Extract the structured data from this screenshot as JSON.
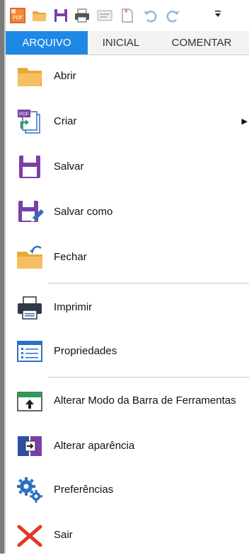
{
  "toolbar": {
    "buttons": [
      {
        "icon": "app-logo-icon"
      },
      {
        "icon": "open-folder-icon"
      },
      {
        "icon": "save-icon"
      },
      {
        "icon": "print-icon"
      },
      {
        "icon": "form-icon"
      },
      {
        "icon": "new-document-icon"
      },
      {
        "icon": "undo-icon"
      },
      {
        "icon": "redo-icon"
      },
      {
        "icon": "customize-dropdown-icon"
      }
    ]
  },
  "tabs": [
    {
      "label": "ARQUIVO",
      "active": true
    },
    {
      "label": "INICIAL",
      "active": false
    },
    {
      "label": "COMENTAR",
      "active": false
    }
  ],
  "menu": {
    "items": [
      {
        "label": "Abrir",
        "icon": "open-folder-icon"
      },
      {
        "label": "Criar",
        "icon": "create-pdf-icon",
        "has_submenu": true,
        "submenu_glyph": "▶"
      },
      {
        "label": "Salvar",
        "icon": "save-icon"
      },
      {
        "label": "Salvar como",
        "icon": "save-as-icon"
      },
      {
        "label": "Fechar",
        "icon": "close-folder-icon"
      },
      {
        "label": "Imprimir",
        "icon": "printer-icon"
      },
      {
        "label": "Propriedades",
        "icon": "properties-icon"
      },
      {
        "label": "Alterar Modo da Barra de Ferramentas",
        "icon": "toolbar-mode-icon"
      },
      {
        "label": "Alterar aparência",
        "icon": "appearance-icon"
      },
      {
        "label": "Preferências",
        "icon": "preferences-gears-icon"
      },
      {
        "label": "Sair",
        "icon": "exit-icon"
      }
    ]
  },
  "colors": {
    "accent": "#1e88e5",
    "folder": "#f5b955",
    "purple": "#7b3fa8",
    "blue": "#2d6fc2",
    "red": "#e0392b"
  }
}
